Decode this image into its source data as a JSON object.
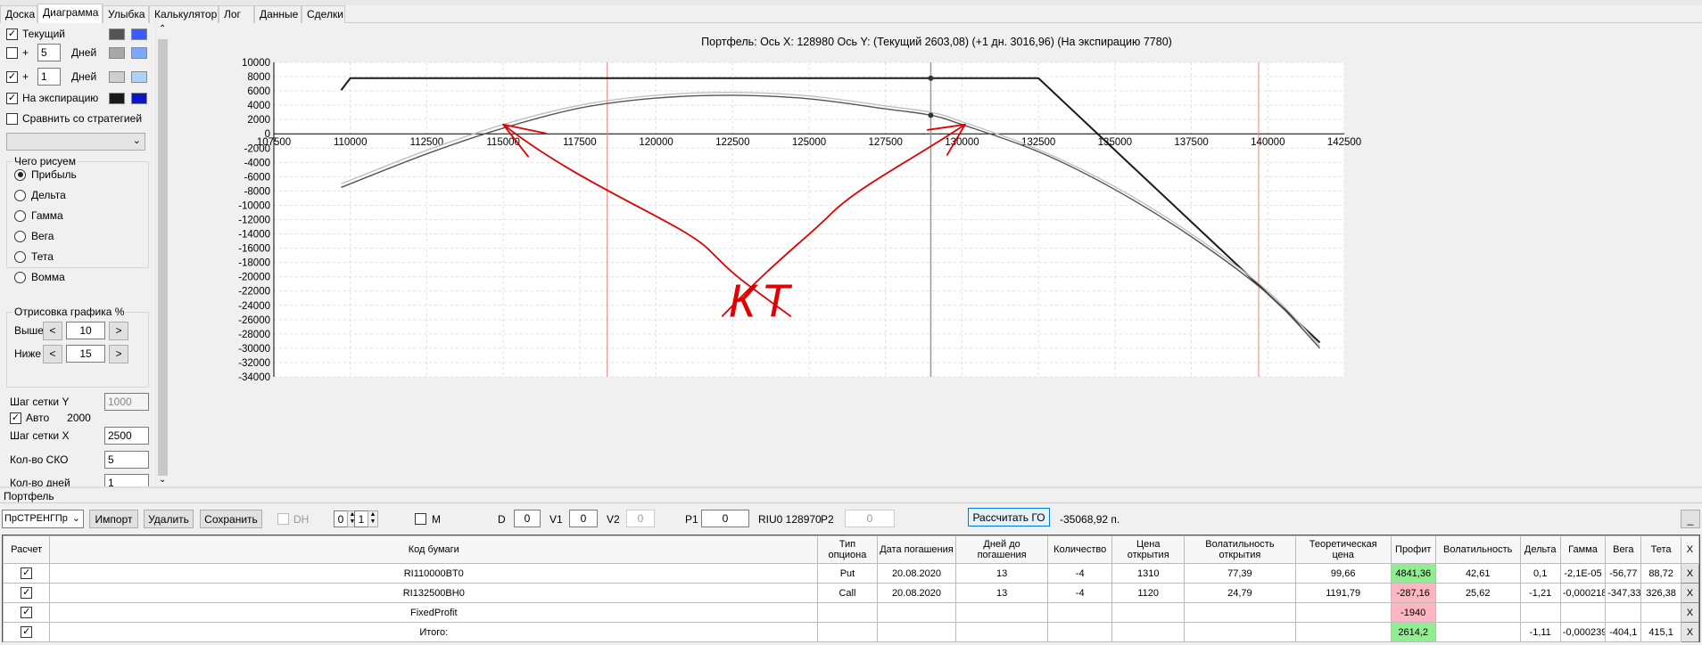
{
  "tabs": [
    {
      "label": "Доска",
      "active": false
    },
    {
      "label": "Диаграмма",
      "active": true
    },
    {
      "label": "Улыбка",
      "active": false
    },
    {
      "label": "Калькулятор",
      "active": false
    },
    {
      "label": "Лог",
      "active": false
    },
    {
      "label": "Данные",
      "active": false
    },
    {
      "label": "Сделки",
      "active": false
    }
  ],
  "left": {
    "current_label": "Текущий",
    "plus1_days": "5",
    "plus2_days": "1",
    "plus_sign": "+",
    "days_label": "Дней",
    "expiry_label": "На экспирацию",
    "compare_label": "Сравнить со стратегией",
    "what_group": "Чего рисуем",
    "radios": [
      "Прибыль",
      "Дельта",
      "Гамма",
      "Вега",
      "Тета",
      "Вомма"
    ],
    "draw_group": "Отрисовка графика %",
    "above_label": "Выше",
    "above_val": "10",
    "below_label": "Ниже",
    "below_val": "15",
    "grid_y_label": "Шаг сетки Y",
    "grid_y_val": "1000",
    "auto_label": "Авто",
    "auto_val": "2000",
    "grid_x_label": "Шаг сетки X",
    "grid_x_val": "2500",
    "sko_label": "Кол-во СКО",
    "sko_val": "5",
    "days_count_label": "Кол-во дней",
    "days_count_val": "1",
    "swatches": {
      "current": [
        "#555555",
        "#3a5bff"
      ],
      "plus1": [
        "#a8a8a8",
        "#7fa6ff"
      ],
      "plus2": [
        "#cfcfcf",
        "#a9d2ff"
      ],
      "expiry": [
        "#1a1a1a",
        "#0a16c8"
      ]
    }
  },
  "chart_title": "Портфель: Ось Х: 128980 Ось Y:  (Текущий 2603,08)  (+1 дн. 3016,96)  (На экспирацию 7780)",
  "annotation_text": "КТ",
  "chart_data": {
    "type": "line",
    "title": "Портфель: Ось Х: 128980 Ось Y:  (Текущий 2603,08)  (+1 дн. 3016,96)  (На экспирацию 7780)",
    "xlim": [
      107500,
      142500
    ],
    "ylim": [
      -34000,
      10000
    ],
    "x_ticks": [
      107500,
      110000,
      112500,
      115000,
      117500,
      120000,
      122500,
      125000,
      127500,
      130000,
      132500,
      135000,
      137500,
      140000,
      142500
    ],
    "y_ticks": [
      10000,
      8000,
      6000,
      4000,
      2000,
      0,
      -2000,
      -4000,
      -6000,
      -8000,
      -10000,
      -12000,
      -14000,
      -16000,
      -18000,
      -20000,
      -22000,
      -24000,
      -26000,
      -28000,
      -30000,
      -32000,
      -34000
    ],
    "cursor_x": 128980,
    "red_vlines": [
      118400,
      139700
    ],
    "series": [
      {
        "key": "expiry",
        "x": [
          109700,
          110000,
          132500,
          141700
        ],
        "y": [
          6100,
          7780,
          7780,
          -29200
        ],
        "color": "#1a1a1a"
      },
      {
        "key": "current",
        "x": [
          109700,
          112500,
          115000,
          117500,
          120000,
          122500,
          125000,
          127500,
          128980,
          130000,
          132500,
          135000,
          137500,
          140000,
          141700
        ],
        "y": [
          -7500,
          -2800,
          800,
          3600,
          5000,
          5400,
          4900,
          3500,
          2603,
          1300,
          -2500,
          -7800,
          -14400,
          -22400,
          -30000
        ],
        "color": "#555555"
      },
      {
        "key": "plus1",
        "x": [
          109700,
          112500,
          115000,
          117500,
          120000,
          122500,
          125000,
          127500,
          128980,
          130000,
          132500,
          135000,
          137500,
          140000,
          141700
        ],
        "y": [
          -7000,
          -2300,
          1300,
          4000,
          5400,
          5800,
          5300,
          3900,
          3017,
          1700,
          -2200,
          -7400,
          -14000,
          -22000,
          -29700
        ],
        "color": "#c0c0c0"
      }
    ],
    "markers": [
      {
        "x": 128980,
        "y": 7780
      },
      {
        "x": 128980,
        "y": 2603
      }
    ],
    "grid": true
  },
  "portfolio": {
    "section_label": "Портфель",
    "strategy": "ПрСТРЕНГПр",
    "import": "Импорт",
    "delete": "Удалить",
    "save": "Сохранить",
    "dh": "DH",
    "dh_a": "0",
    "dh_b": "1",
    "m": "M",
    "d_label": "D",
    "d_val": "0",
    "v1_label": "V1",
    "v1_val": "0",
    "v2_label": "V2",
    "v2_val": "0",
    "p1_label": "P1",
    "p1_val": "0",
    "riu": "RIU0 128970",
    "p2_label": "P2",
    "p2_val": "0",
    "calc": "Рассчитать ГО",
    "go_val": "-35068,92 п.",
    "underscore": "_"
  },
  "table": {
    "headers": [
      "Расчет",
      "Код бумаги",
      "Тип опциона",
      "Дата погашения",
      "Дней до погашения",
      "Количество",
      "Цена открытия",
      "Волатильность открытия",
      "Теоретическая цена",
      "Профит",
      "Волатильность",
      "Дельта",
      "Гамма",
      "Вега",
      "Тета",
      "X"
    ],
    "rows": [
      {
        "code": "RI110000BT0",
        "type": "Put",
        "date": "20.08.2020",
        "days": "13",
        "qty": "-4",
        "price": "1310",
        "vol_open": "77,39",
        "theo": "99,66",
        "profit": "4841,36",
        "profit_color": "green",
        "vol": "42,61",
        "delta": "0,1",
        "gamma": "-2,1E-05",
        "vega": "-56,77",
        "theta": "88,72",
        "x": "X"
      },
      {
        "code": "RI132500BH0",
        "type": "Call",
        "date": "20.08.2020",
        "days": "13",
        "qty": "-4",
        "price": "1120",
        "vol_open": "24,79",
        "theo": "1191,79",
        "profit": "-287,16",
        "profit_color": "pink",
        "vol": "25,62",
        "delta": "-1,21",
        "gamma": "-0,000218",
        "vega": "-347,33",
        "theta": "326,38",
        "x": "X"
      },
      {
        "code": "FixedProfit",
        "type": "",
        "date": "",
        "days": "",
        "qty": "",
        "price": "",
        "vol_open": "",
        "theo": "",
        "profit": "-1940",
        "profit_color": "pink",
        "vol": "",
        "delta": "",
        "gamma": "",
        "vega": "",
        "theta": "",
        "x": "X"
      },
      {
        "code": "Итого:",
        "type": "",
        "date": "",
        "days": "",
        "qty": "",
        "price": "",
        "vol_open": "",
        "theo": "",
        "profit": "2614,2",
        "profit_color": "green",
        "vol": "",
        "delta": "-1,11",
        "gamma": "-0,000239",
        "vega": "-404,1",
        "theta": "415,1",
        "x": "X"
      }
    ]
  }
}
